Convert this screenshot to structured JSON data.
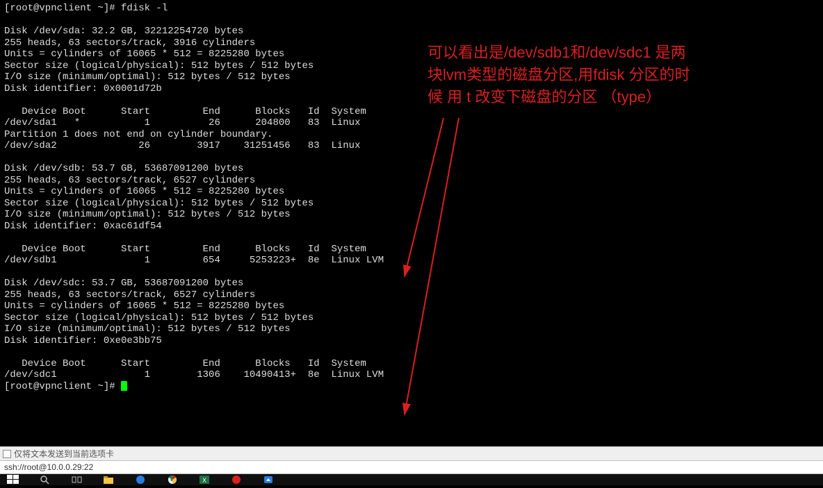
{
  "terminal": {
    "prompt1": "[root@vpnclient ~]# fdisk -l",
    "blank": "",
    "sda_l1": "Disk /dev/sda: 32.2 GB, 32212254720 bytes",
    "sda_l2": "255 heads, 63 sectors/track, 3916 cylinders",
    "sda_l3": "Units = cylinders of 16065 * 512 = 8225280 bytes",
    "sda_l4": "Sector size (logical/physical): 512 bytes / 512 bytes",
    "sda_l5": "I/O size (minimum/optimal): 512 bytes / 512 bytes",
    "sda_l6": "Disk identifier: 0x0001d72b",
    "hdr": "   Device Boot      Start         End      Blocks   Id  System",
    "sda_p1": "/dev/sda1   *           1          26      204800   83  Linux",
    "sda_note": "Partition 1 does not end on cylinder boundary.",
    "sda_p2": "/dev/sda2              26        3917    31251456   83  Linux",
    "sdb_l1": "Disk /dev/sdb: 53.7 GB, 53687091200 bytes",
    "sdb_l2": "255 heads, 63 sectors/track, 6527 cylinders",
    "sdb_l3": "Units = cylinders of 16065 * 512 = 8225280 bytes",
    "sdb_l4": "Sector size (logical/physical): 512 bytes / 512 bytes",
    "sdb_l5": "I/O size (minimum/optimal): 512 bytes / 512 bytes",
    "sdb_l6": "Disk identifier: 0xac61df54",
    "sdb_p1": "/dev/sdb1               1         654     5253223+  8e  Linux LVM",
    "sdc_l1": "Disk /dev/sdc: 53.7 GB, 53687091200 bytes",
    "sdc_l2": "255 heads, 63 sectors/track, 6527 cylinders",
    "sdc_l3": "Units = cylinders of 16065 * 512 = 8225280 bytes",
    "sdc_l4": "Sector size (logical/physical): 512 bytes / 512 bytes",
    "sdc_l5": "I/O size (minimum/optimal): 512 bytes / 512 bytes",
    "sdc_l6": "Disk identifier: 0xe0e3bb75",
    "sdc_p1": "/dev/sdc1               1        1306    10490413+  8e  Linux LVM",
    "prompt2": "[root@vpnclient ~]# "
  },
  "annotation": {
    "line1": "可以看出是/dev/sdb1和/dev/sdc1 是两",
    "line2": "块lvm类型的磁盘分区,用fdisk  分区的时",
    "line3": "候 用 t 改变下磁盘的分区 （type）"
  },
  "option_bar": {
    "label": "仅将文本发送到当前选项卡"
  },
  "url_bar": {
    "text": "ssh://root@10.0.0.29:22"
  }
}
